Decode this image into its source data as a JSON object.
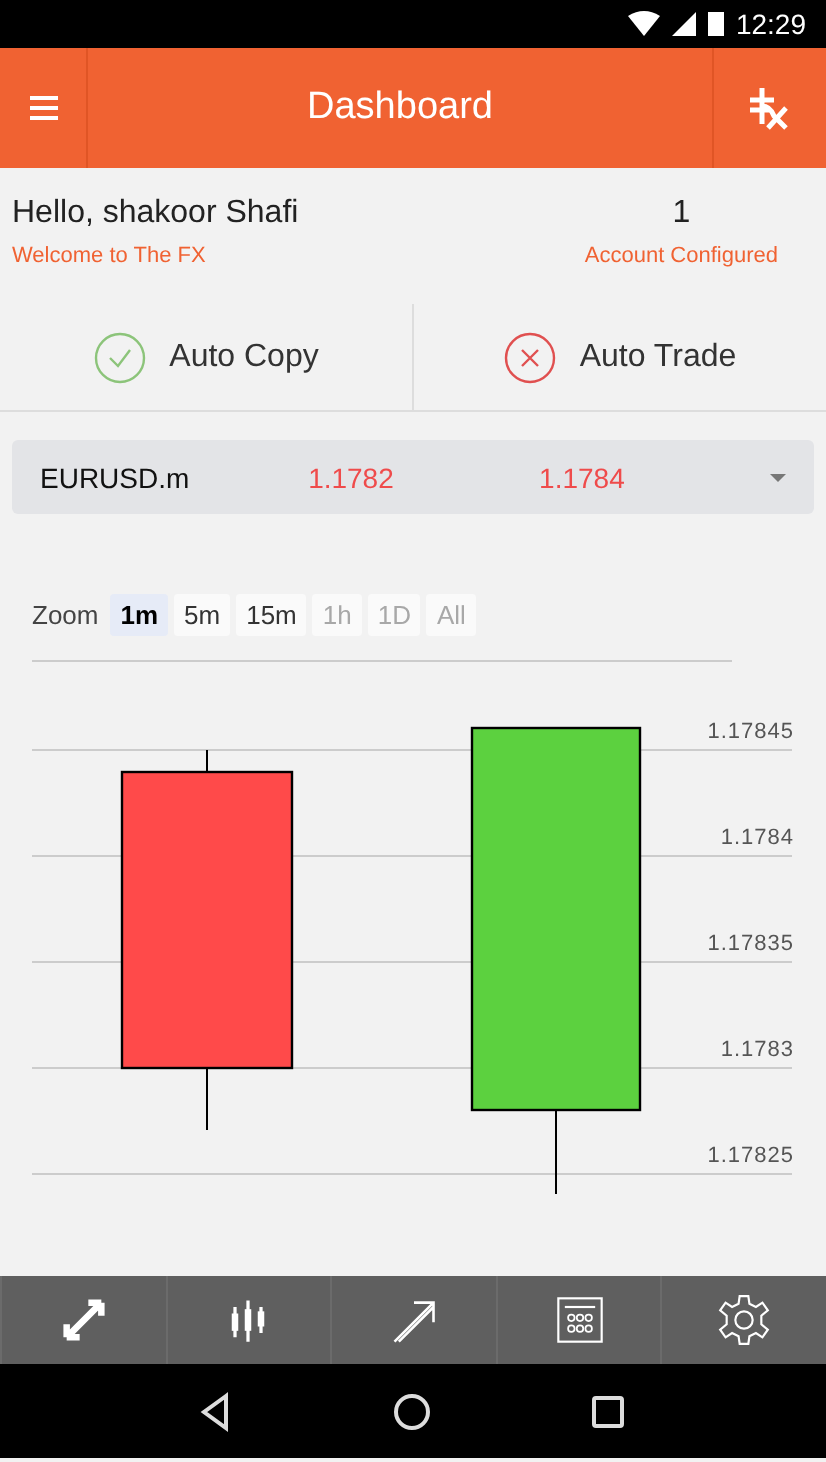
{
  "status_bar": {
    "time": "12:29"
  },
  "app_bar": {
    "title": "Dashboard"
  },
  "greeting": {
    "name": "Hello, shakoor Shafi",
    "subtitle": "Welcome to The FX",
    "count": "1",
    "count_label": "Account Configured"
  },
  "toggles": [
    {
      "label": "Auto Copy",
      "on": true
    },
    {
      "label": "Auto Trade",
      "on": false
    }
  ],
  "symbol": {
    "name": "EURUSD.m",
    "bid": "1.1782",
    "ask": "1.1784"
  },
  "zoom": {
    "label": "Zoom",
    "options": [
      {
        "label": "1m",
        "selected": true,
        "disabled": false
      },
      {
        "label": "5m",
        "selected": false,
        "disabled": false
      },
      {
        "label": "15m",
        "selected": false,
        "disabled": false
      },
      {
        "label": "1h",
        "selected": false,
        "disabled": true
      },
      {
        "label": "1D",
        "selected": false,
        "disabled": true
      },
      {
        "label": "All",
        "selected": false,
        "disabled": true
      }
    ]
  },
  "chart": {
    "y_labels": [
      "1.17845",
      "1.1784",
      "1.17835",
      "1.1783",
      "1.17825"
    ],
    "candles": [
      {
        "color": "#ff4a4a"
      },
      {
        "color": "#5cd13f"
      }
    ]
  }
}
